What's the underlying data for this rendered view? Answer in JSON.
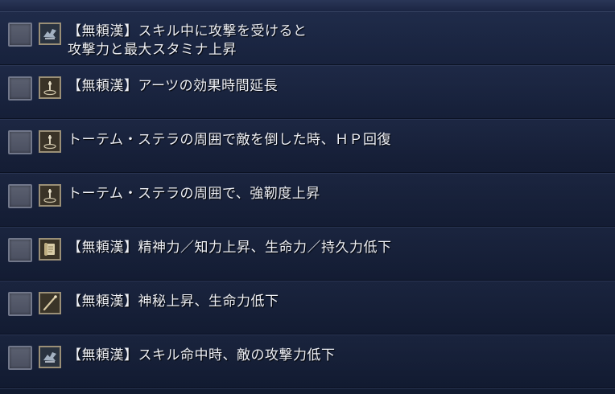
{
  "skills": [
    {
      "icon": "winged-hand-icon",
      "label": "【無頼漢】スキル中に攻撃を受けると\n攻撃力と最大スタミナ上昇",
      "checked": false
    },
    {
      "icon": "totem-icon",
      "label": "【無頼漢】アーツの効果時間延長",
      "checked": false
    },
    {
      "icon": "totem-icon",
      "label": "トーテム・ステラの周囲で敵を倒した時、ＨＰ回復",
      "checked": false
    },
    {
      "icon": "totem-icon",
      "label": "トーテム・ステラの周囲で、強靭度上昇",
      "checked": false
    },
    {
      "icon": "scroll-icon",
      "label": "【無頼漢】精神力／知力上昇、生命力／持久力低下",
      "checked": false
    },
    {
      "icon": "staff-icon",
      "label": "【無頼漢】神秘上昇、生命力低下",
      "checked": false
    },
    {
      "icon": "winged-hand-icon",
      "label": "【無頼漢】スキル命中時、敵の攻撃力低下",
      "checked": false
    }
  ]
}
